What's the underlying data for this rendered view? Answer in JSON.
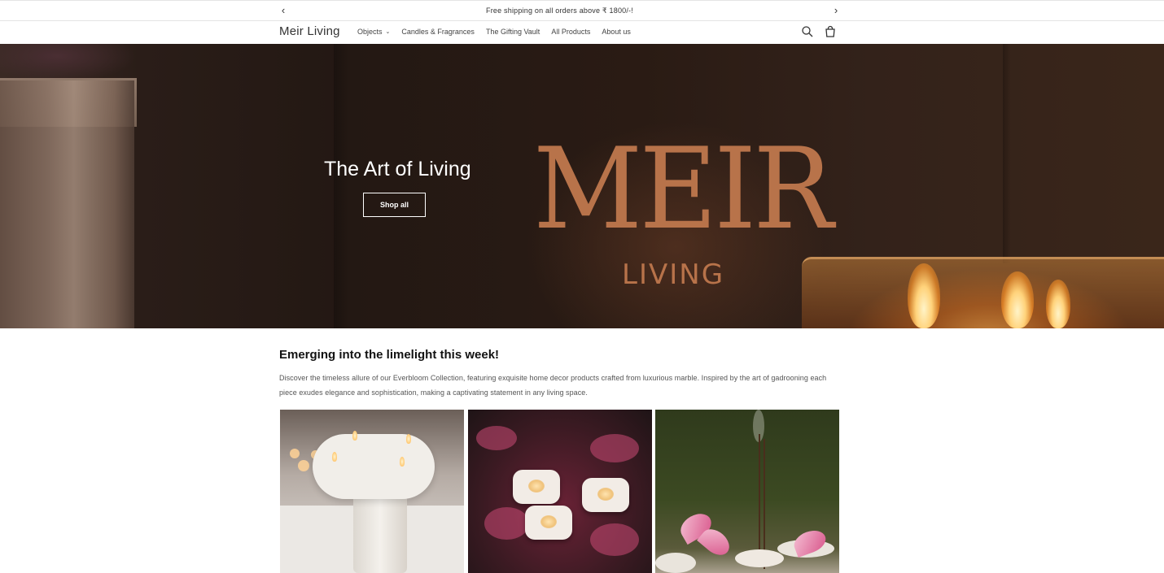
{
  "announcement": {
    "text": "Free shipping on all orders above ₹ 1800/-!",
    "prev_icon": "chevron-left-icon",
    "next_icon": "chevron-right-icon"
  },
  "header": {
    "logo": "Meir Living",
    "nav": [
      {
        "label": "Objects",
        "has_dropdown": true
      },
      {
        "label": "Candles & Fragrances"
      },
      {
        "label": "The Gifting Vault"
      },
      {
        "label": "All Products"
      },
      {
        "label": "About us"
      }
    ],
    "icons": [
      "search-icon",
      "cart-icon"
    ]
  },
  "hero": {
    "headline": "The Art of Living",
    "button": "Shop all",
    "brand_main": "MEIR",
    "brand_sub": "LIVING"
  },
  "section": {
    "title": "Emerging into the limelight this week!",
    "description": "Discover the timeless allure of our Everbloom Collection, featuring exquisite home decor products crafted from luxurious marble. Inspired by the art of gadrooning each piece exudes elegance and sophistication, making a captivating statement in any living space."
  },
  "colors": {
    "accent": "#b8734a",
    "text": "#121212"
  }
}
